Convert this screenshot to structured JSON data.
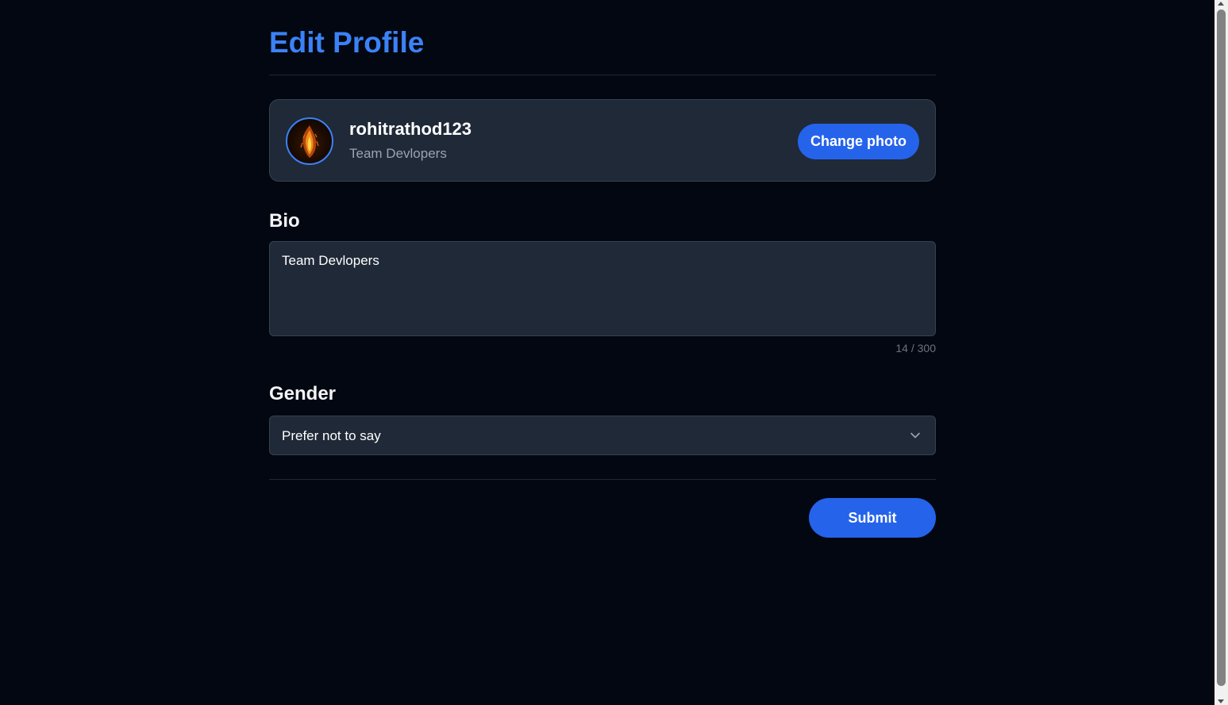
{
  "page": {
    "title": "Edit Profile"
  },
  "profile": {
    "username": "rohitrathod123",
    "subtitle": "Team Devlopers",
    "change_photo_label": "Change photo",
    "avatar_icon": "flame-avatar-icon"
  },
  "bio": {
    "label": "Bio",
    "value": "Team Devlopers",
    "counter": "14 / 300"
  },
  "gender": {
    "label": "Gender",
    "selected": "Prefer not to say"
  },
  "form": {
    "submit_label": "Submit"
  },
  "colors": {
    "background": "#030712",
    "accent": "#3b82f6",
    "button": "#2563eb",
    "card": "#1f2937",
    "border": "#374151",
    "muted_text": "#9ca3af"
  }
}
